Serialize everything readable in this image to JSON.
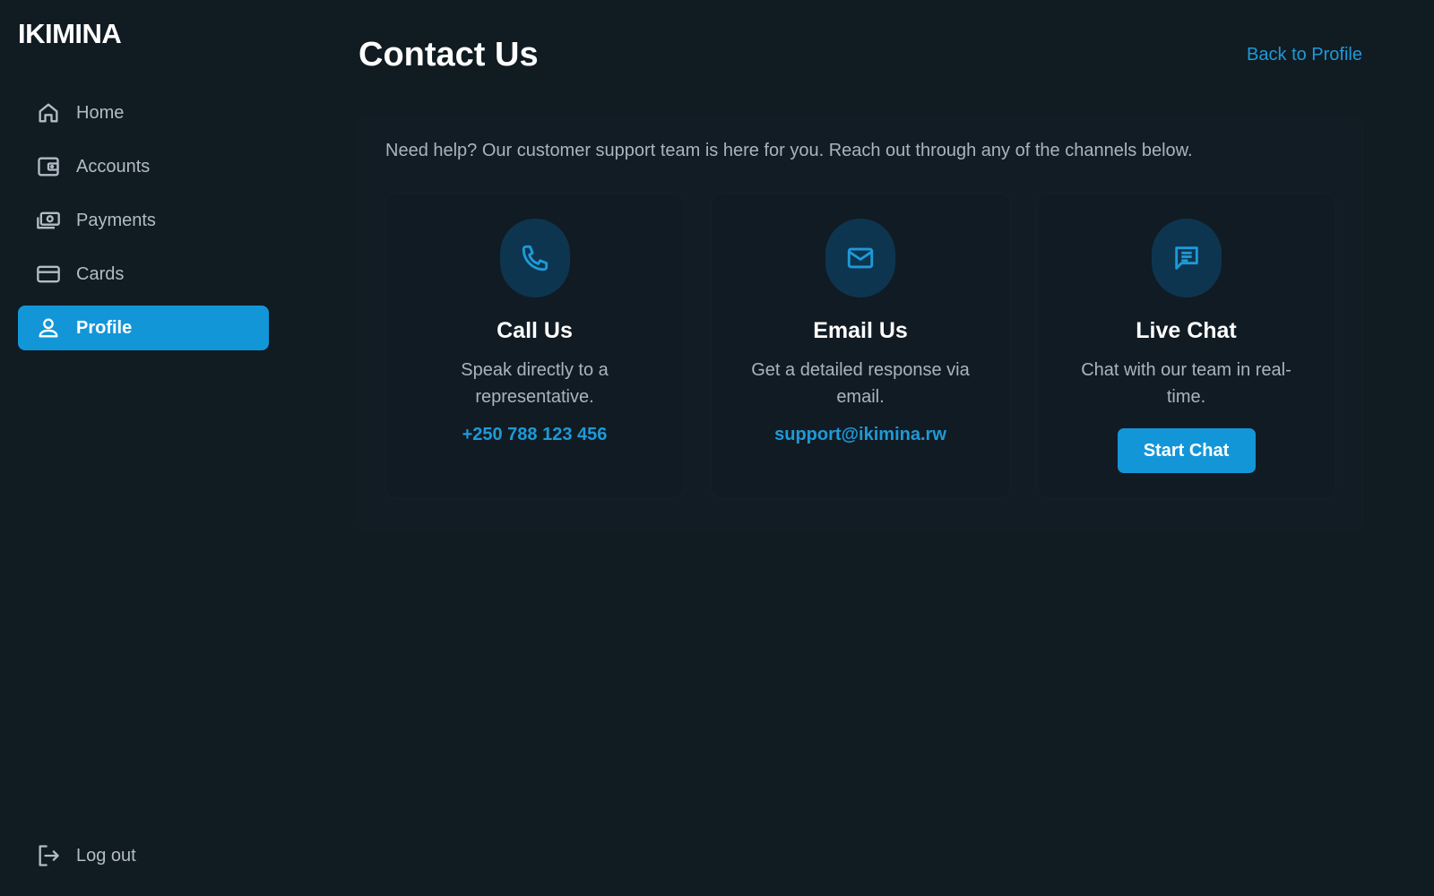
{
  "brand": "IKIMINA",
  "sidebar": {
    "items": [
      {
        "label": "Home",
        "icon": "home-icon"
      },
      {
        "label": "Accounts",
        "icon": "wallet-icon"
      },
      {
        "label": "Payments",
        "icon": "cash-icon"
      },
      {
        "label": "Cards",
        "icon": "credit-card-icon"
      },
      {
        "label": "Profile",
        "icon": "user-icon",
        "active": true
      }
    ],
    "logout_label": "Log out",
    "logout_icon": "logout-icon"
  },
  "header": {
    "title": "Contact Us",
    "back_link": "Back to Profile"
  },
  "main": {
    "intro": "Need help? Our customer support team is here for you. Reach out through any of the channels below.",
    "cards": [
      {
        "icon": "phone-icon",
        "title": "Call Us",
        "description": "Speak directly to a representative.",
        "link": "+250 788 123 456"
      },
      {
        "icon": "mail-icon",
        "title": "Email Us",
        "description": "Get a detailed response via email.",
        "link": "support@ikimina.rw"
      },
      {
        "icon": "chat-icon",
        "title": "Live Chat",
        "description": "Chat with our team in real-time.",
        "button": "Start Chat"
      }
    ]
  },
  "colors": {
    "background": "#111b22",
    "accent": "#1396d8",
    "link": "#1e9ad8",
    "icon_circle": "#0e3550",
    "muted_text": "#aab4be"
  }
}
